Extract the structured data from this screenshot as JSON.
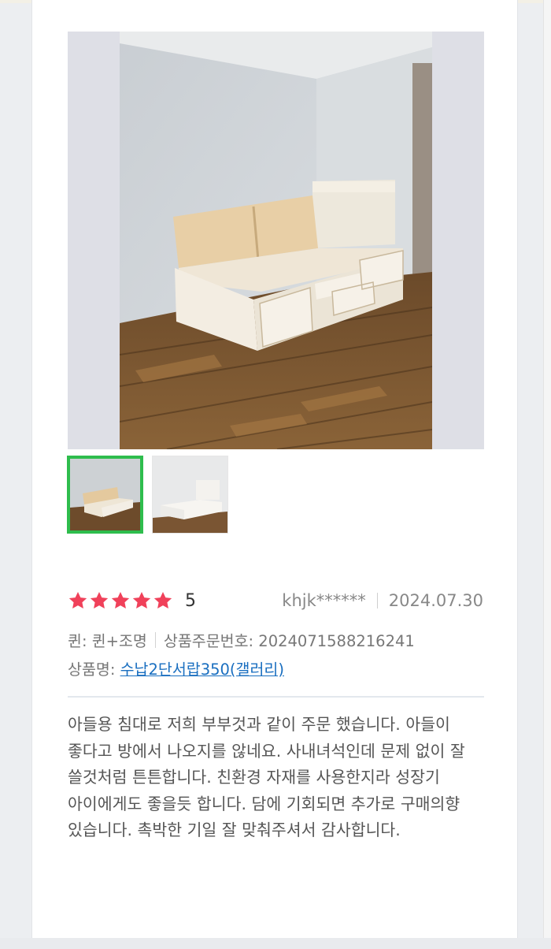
{
  "review": {
    "main_image_alt": "",
    "thumbnails": [
      {
        "name": "thumb-bed-with-drawers",
        "active": true
      },
      {
        "name": "thumb-bed-white",
        "active": false
      }
    ],
    "stars": 5,
    "rating": "5",
    "reviewer": "khjk******",
    "date": "2024.07.30",
    "option": "퀸: 퀸+조명",
    "order_number": "상품주문번호: 2024071588216241",
    "product_label": "상품명: ",
    "product_link": "수납2단서랍350(갤러리)",
    "body": "아들용 침대로 저희 부부것과 같이 주문 했습니다. 아들이 좋다고 방에서 나오지를 않네요. 사내녀석인데 문제 없이 잘 쓸것처럼 튼튼합니다. 친환경 자재를 사용한지라 성장기 아이에게도 좋을듯 합니다. 담에 기회되면 추가로 구매의향 있습니다. 촉박한 기일 잘 맞춰주셔서 감사합니다."
  },
  "colors": {
    "star": "#f0415a",
    "thumb_active_border": "#2ebd4d",
    "link": "#1a6fc0"
  }
}
